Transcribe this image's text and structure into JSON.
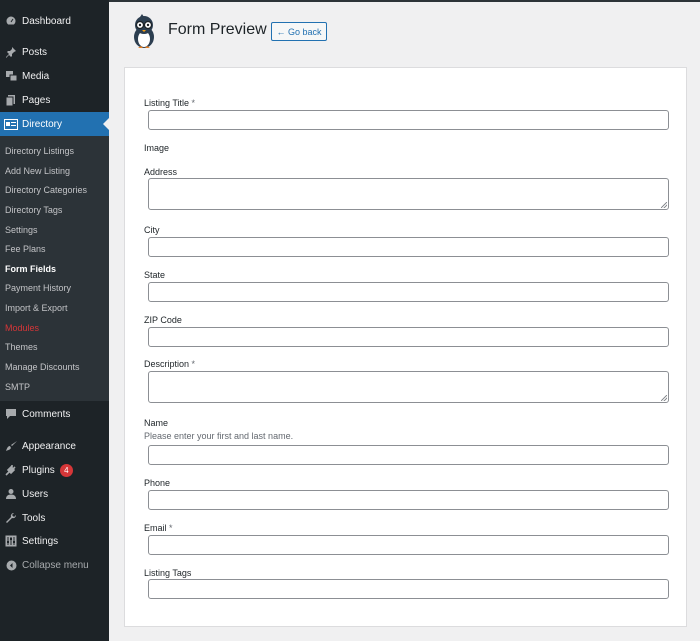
{
  "sidebar": {
    "menu": [
      {
        "label": "Dashboard",
        "icon": "dashboard-icon"
      },
      {
        "label": "Posts",
        "icon": "pushpin-icon"
      },
      {
        "label": "Media",
        "icon": "media-icon"
      },
      {
        "label": "Pages",
        "icon": "pages-icon"
      },
      {
        "label": "Directory",
        "icon": "id-card-icon",
        "active": true
      }
    ],
    "submenu": [
      {
        "label": "Directory Listings"
      },
      {
        "label": "Add New Listing"
      },
      {
        "label": "Directory Categories"
      },
      {
        "label": "Directory Tags"
      },
      {
        "label": "Settings"
      },
      {
        "label": "Fee Plans"
      },
      {
        "label": "Form Fields",
        "current": true
      },
      {
        "label": "Payment History"
      },
      {
        "label": "Import & Export"
      },
      {
        "label": "Modules",
        "highlight": true
      },
      {
        "label": "Themes"
      },
      {
        "label": "Manage Discounts"
      },
      {
        "label": "SMTP"
      }
    ],
    "menu_lower": [
      {
        "label": "Comments",
        "icon": "comment-icon"
      },
      {
        "label": "Appearance",
        "icon": "paintbrush-icon"
      },
      {
        "label": "Plugins",
        "icon": "plugin-icon",
        "badge": "4"
      },
      {
        "label": "Users",
        "icon": "user-icon"
      },
      {
        "label": "Tools",
        "icon": "wrench-icon"
      },
      {
        "label": "Settings",
        "icon": "settings-sliders-icon"
      },
      {
        "label": "Collapse menu",
        "icon": "collapse-icon"
      }
    ]
  },
  "header": {
    "title": "Form Preview",
    "go_back_label": "← Go back"
  },
  "form": {
    "required_marker": "*",
    "fields": [
      {
        "label": "Listing Title",
        "required": true,
        "type": "text",
        "value": ""
      },
      {
        "label": "Image",
        "required": false,
        "type": "image"
      },
      {
        "label": "Address",
        "required": false,
        "type": "textarea",
        "value": ""
      },
      {
        "label": "City",
        "required": false,
        "type": "text",
        "value": ""
      },
      {
        "label": "State",
        "required": false,
        "type": "text",
        "value": ""
      },
      {
        "label": "ZIP Code",
        "required": false,
        "type": "text",
        "value": ""
      },
      {
        "label": "Description",
        "required": true,
        "type": "textarea",
        "value": ""
      },
      {
        "label": "Name",
        "required": false,
        "type": "text",
        "description": "Please enter your first and last name.",
        "value": ""
      },
      {
        "label": "Phone",
        "required": false,
        "type": "text",
        "value": ""
      },
      {
        "label": "Email",
        "required": true,
        "type": "text",
        "value": ""
      },
      {
        "label": "Listing Tags",
        "required": false,
        "type": "text",
        "value": ""
      }
    ]
  },
  "colors": {
    "sidebar_bg": "#1d2327",
    "submenu_bg": "#2c3338",
    "accent": "#2271b1",
    "badge": "#d63638",
    "highlight": "#d63638"
  }
}
